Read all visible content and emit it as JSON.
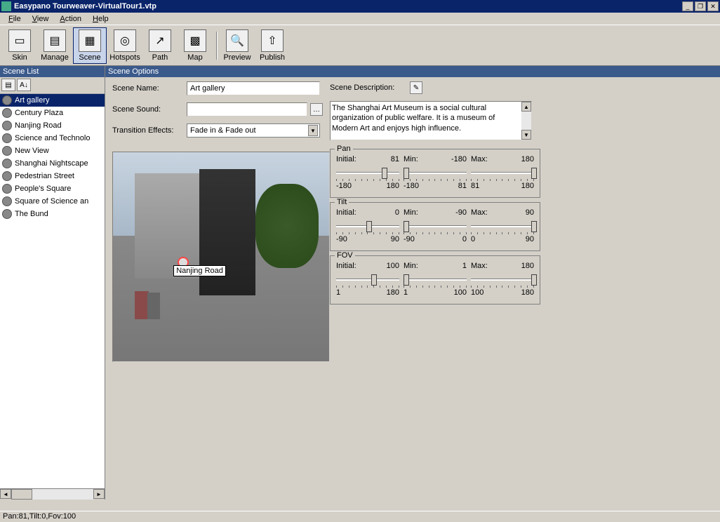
{
  "window": {
    "title": "Easypano Tourweaver-VirtualTour1.vtp"
  },
  "menus": [
    "File",
    "View",
    "Action",
    "Help"
  ],
  "toolbar": [
    {
      "label": "Skin",
      "icon": "▭"
    },
    {
      "label": "Manage",
      "icon": "▤"
    },
    {
      "label": "Scene",
      "icon": "▦",
      "active": true
    },
    {
      "label": "Hotspots",
      "icon": "◎"
    },
    {
      "label": "Path",
      "icon": "↗"
    },
    {
      "label": "Map",
      "icon": "▩"
    },
    {
      "label": "Preview",
      "icon": "🔍"
    },
    {
      "label": "Publish",
      "icon": "⇧"
    }
  ],
  "panels": {
    "sceneList": "Scene List",
    "sceneOptions": "Scene Options"
  },
  "scenes": [
    {
      "name": "Art gallery",
      "selected": true
    },
    {
      "name": "Century Plaza"
    },
    {
      "name": "Nanjing Road"
    },
    {
      "name": "Science and Technolo"
    },
    {
      "name": "New View"
    },
    {
      "name": "Shanghai Nightscape"
    },
    {
      "name": "Pedestrian Street"
    },
    {
      "name": "People's Square"
    },
    {
      "name": "Square of Science an"
    },
    {
      "name": "The Bund"
    }
  ],
  "fields": {
    "sceneNameLabel": "Scene Name:",
    "sceneNameValue": "Art gallery",
    "sceneSoundLabel": "Scene Sound:",
    "sceneSoundValue": "",
    "transitionLabel": "Transition Effects:",
    "transitionValue": "Fade in & Fade out",
    "sceneDescLabel": "Scene Description:",
    "sceneDescValue": "The Shanghai Art Museum is a social cultural organization of public welfare. It is a museum of Modern Art and enjoys high influence."
  },
  "hotspotLabel": "Nanjing Road",
  "sliders": {
    "pan": {
      "title": "Pan",
      "initialLabel": "Initial:",
      "initial": 81,
      "minLabel": "Min:",
      "min": -180,
      "maxLabel": "Max:",
      "max": 180,
      "initRange": {
        "lo": -180,
        "hi": 180,
        "pct": 72
      },
      "minRange": {
        "lo": -180,
        "hi": 81,
        "pct": 0
      },
      "maxRange": {
        "lo": 81,
        "hi": 180,
        "pct": 95
      }
    },
    "tilt": {
      "title": "Tilt",
      "initialLabel": "Initial:",
      "initial": 0,
      "minLabel": "Min:",
      "min": -90,
      "maxLabel": "Max:",
      "max": 90,
      "initRange": {
        "lo": -90,
        "hi": 90,
        "pct": 48
      },
      "minRange": {
        "lo": -90,
        "hi": 0,
        "pct": 0
      },
      "maxRange": {
        "lo": 0,
        "hi": 90,
        "pct": 95
      }
    },
    "fov": {
      "title": "FOV",
      "initialLabel": "Initial:",
      "initial": 100,
      "minLabel": "Min:",
      "min": 1,
      "maxLabel": "Max:",
      "max": 180,
      "initRange": {
        "lo": 1,
        "hi": 180,
        "pct": 55
      },
      "minRange": {
        "lo": 1,
        "hi": 100,
        "pct": 0
      },
      "maxRange": {
        "lo": 100,
        "hi": 180,
        "pct": 95
      }
    }
  },
  "statusbar": "Pan:81,Tilt:0,Fov:100"
}
